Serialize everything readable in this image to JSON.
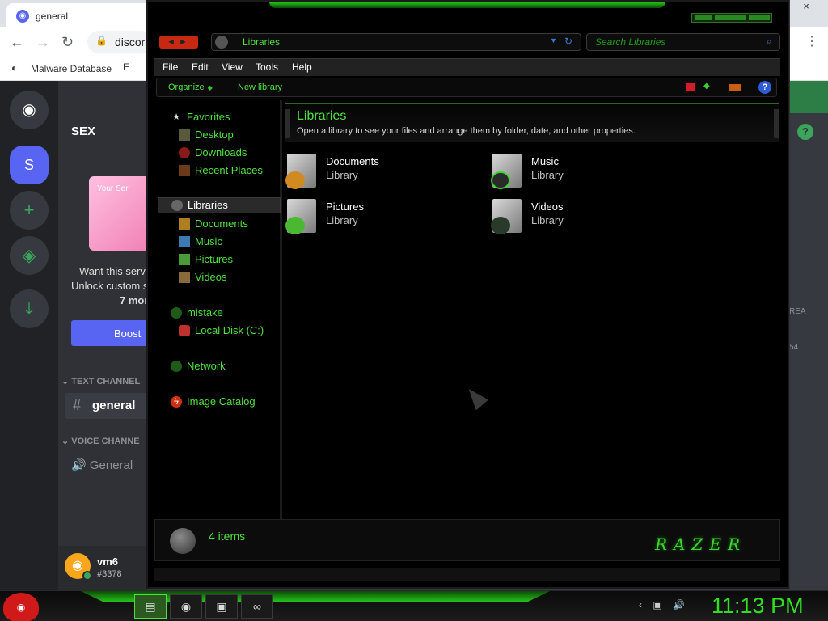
{
  "browser": {
    "tab_title": "general",
    "tab_favicon": "discord-icon",
    "close_glyph": "×",
    "url": "discor",
    "bookmarks": [
      {
        "label": "Malware Database"
      },
      {
        "label": "E"
      }
    ]
  },
  "discord": {
    "server_name": "SEX",
    "server_initial": "S",
    "promo_title": "Your Ser",
    "promo_text_line1": "Want this serv",
    "promo_text_line2": "Unlock custom s",
    "promo_text_line3": "7 mor",
    "boost_label": "Boost",
    "text_channels_header": "TEXT CHANNEL",
    "voice_channels_header": "VOICE CHANNE",
    "channel_general": "general",
    "voice_general": "General",
    "user_name": "vm6",
    "user_disc": "#3378",
    "right_text1": "REA",
    "right_text2": "54"
  },
  "explorer": {
    "address": "Libraries",
    "search_placeholder": "Search Libraries",
    "menu": [
      "File",
      "Edit",
      "View",
      "Tools",
      "Help"
    ],
    "toolbar": {
      "organize": "Organize",
      "new_library": "New library"
    },
    "nav": {
      "favorites": "Favorites",
      "desktop": "Desktop",
      "downloads": "Downloads",
      "recent": "Recent Places",
      "libraries": "Libraries",
      "documents": "Documents",
      "music": "Music",
      "pictures": "Pictures",
      "videos": "Videos",
      "mistake": "mistake",
      "local_disk": "Local Disk (C:)",
      "network": "Network",
      "image_catalog": "Image Catalog"
    },
    "header": {
      "title": "Libraries",
      "desc": "Open a library to see your files and arrange them by folder, date, and other properties."
    },
    "libraries": [
      {
        "name": "Documents",
        "type": "Library"
      },
      {
        "name": "Music",
        "type": "Library"
      },
      {
        "name": "Pictures",
        "type": "Library"
      },
      {
        "name": "Videos",
        "type": "Library"
      }
    ],
    "status": "4 items",
    "brand": "Razer"
  },
  "taskbar": {
    "clock": "11:13 PM"
  },
  "colors": {
    "accent": "#4fe040",
    "discord_blurple": "#5865f2",
    "discord_green": "#3ba55c"
  }
}
